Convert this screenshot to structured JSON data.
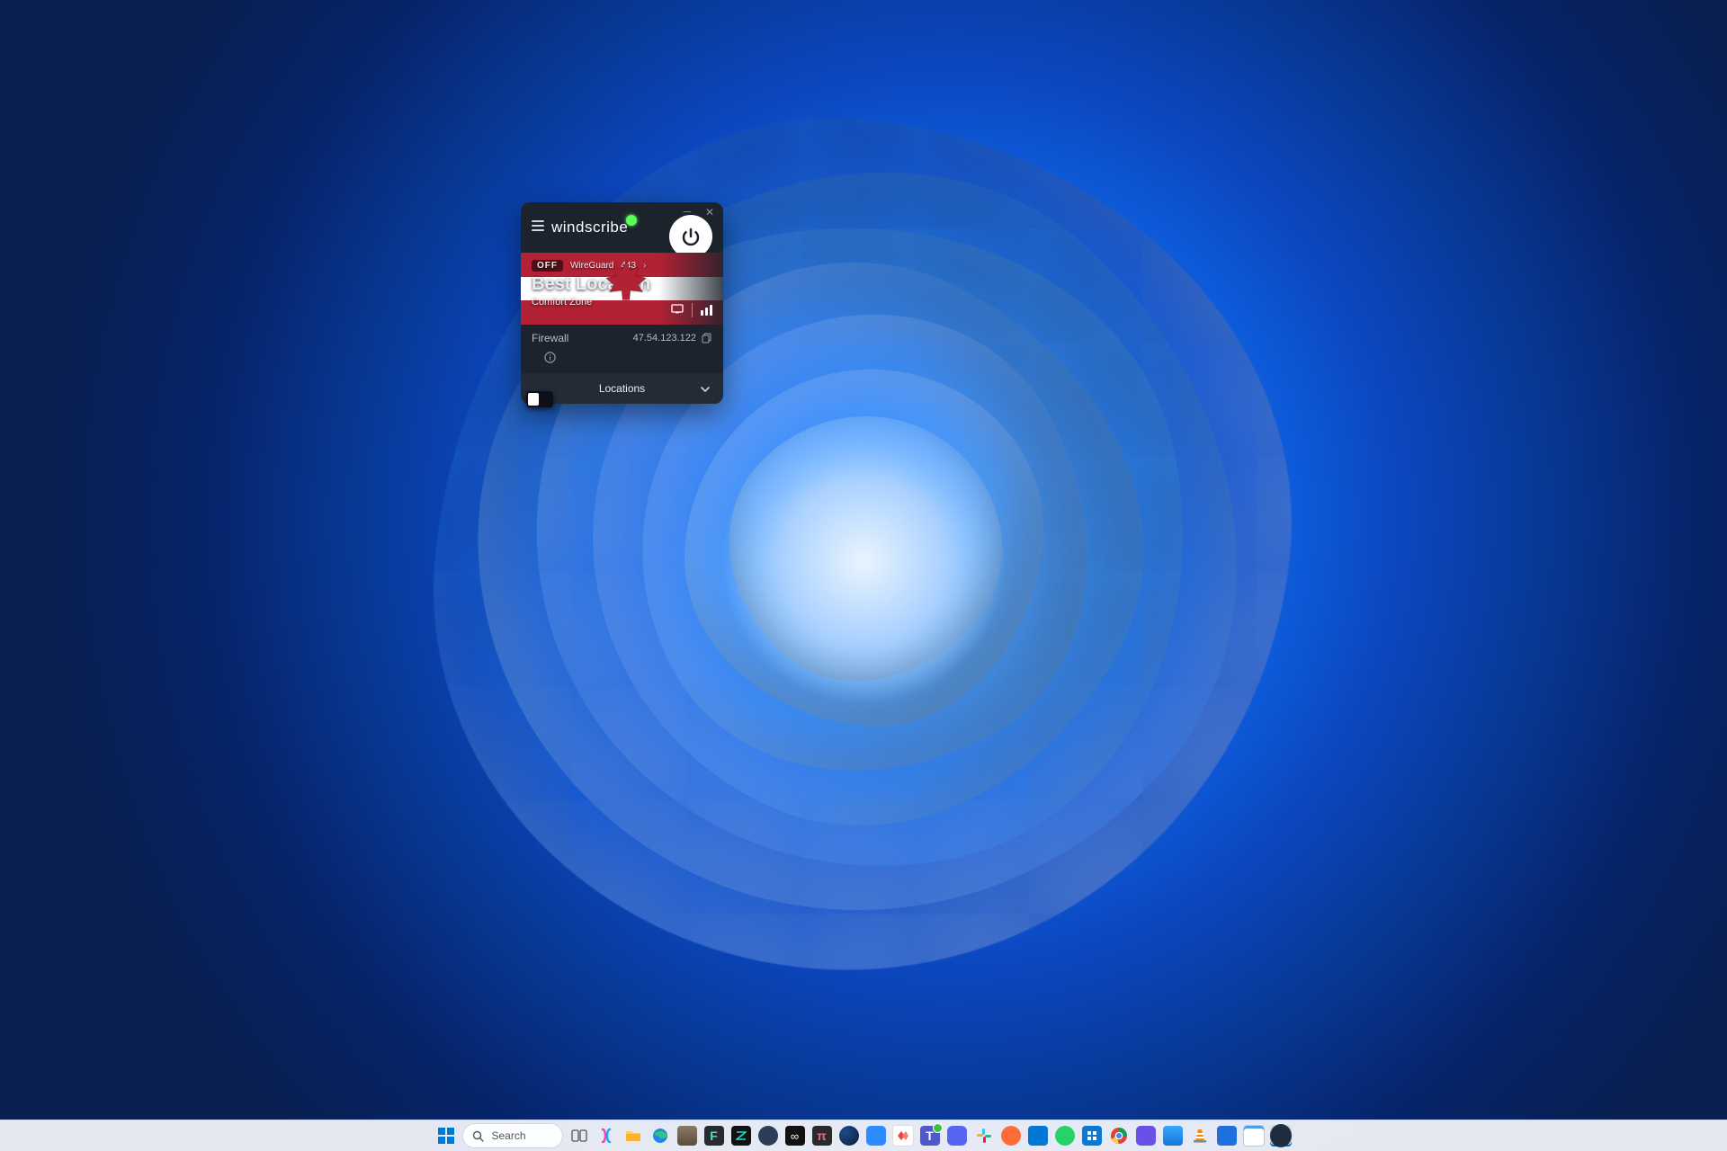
{
  "app": {
    "brand": "windscribe",
    "status_off": "OFF",
    "protocol": "WireGuard",
    "port": "443",
    "location_title": "Best Location",
    "location_sub": "Comfort Zone",
    "firewall_label": "Firewall",
    "ip": "47.54.123.122",
    "locations_label": "Locations"
  },
  "taskbar": {
    "search_placeholder": "Search",
    "icons": [
      {
        "name": "start-icon"
      },
      {
        "name": "search-box"
      },
      {
        "name": "task-view-icon"
      },
      {
        "name": "copilot-icon"
      },
      {
        "name": "file-explorer-icon"
      },
      {
        "name": "edge-icon"
      },
      {
        "name": "gimp-icon"
      },
      {
        "name": "filmora-icon"
      },
      {
        "name": "capcut-icon"
      },
      {
        "name": "obs-icon"
      },
      {
        "name": "meta-icon"
      },
      {
        "name": "raspberry-pi-icon"
      },
      {
        "name": "steam-icon"
      },
      {
        "name": "zoom-icon"
      },
      {
        "name": "anydesk-icon"
      },
      {
        "name": "teams-icon"
      },
      {
        "name": "discord-icon"
      },
      {
        "name": "slack-icon"
      },
      {
        "name": "postman-icon"
      },
      {
        "name": "vscode-icon"
      },
      {
        "name": "whatsapp-icon"
      },
      {
        "name": "microsoft-store-icon"
      },
      {
        "name": "chrome-icon"
      },
      {
        "name": "clipchamp-icon"
      },
      {
        "name": "fences-icon"
      },
      {
        "name": "vlc-icon"
      },
      {
        "name": "groove-music-icon"
      },
      {
        "name": "notepad-icon"
      },
      {
        "name": "windscribe-taskbar-icon"
      }
    ]
  }
}
